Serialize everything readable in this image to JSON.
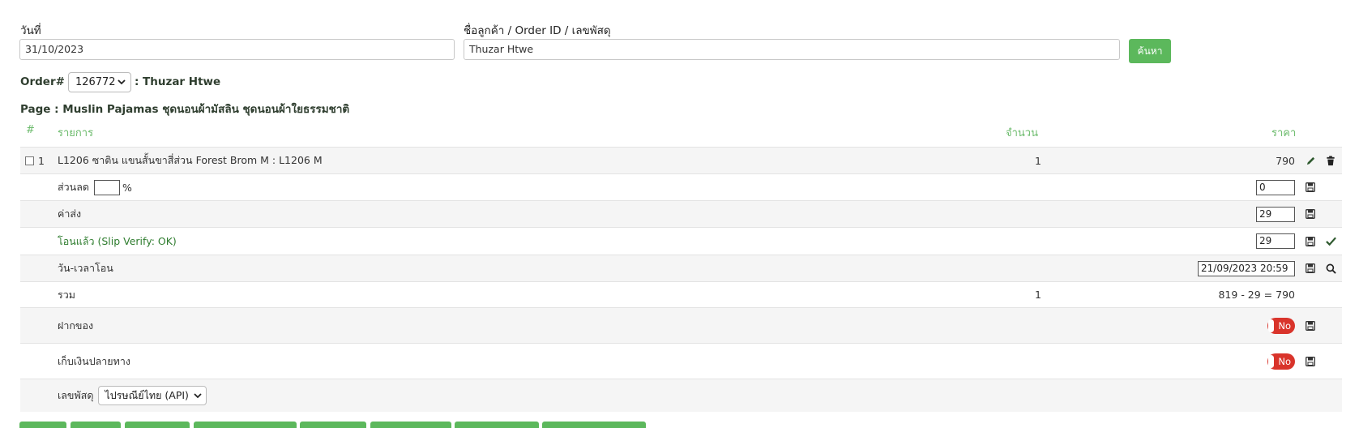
{
  "filters": {
    "date_label": "วันที่",
    "date_value": "31/10/2023",
    "customer_label": "ชื่อลูกค้า / Order ID / เลขพัสดุ",
    "customer_value": "Thuzar Htwe",
    "search_button": "ค้นหา"
  },
  "order": {
    "prefix": "Order#",
    "id": "126772",
    "customer": ": Thuzar Htwe",
    "page_title": "Page : Muslin Pajamas ชุดนอนผ้ามัสลิน ชุดนอนผ้าใยธรรมชาติ"
  },
  "table": {
    "headers": {
      "index": "#",
      "item": "รายการ",
      "qty": "จำนวน",
      "price": "ราคา"
    },
    "item": {
      "index": "1",
      "name": "L1206 ซาติน แขนสั้นขาสี่ส่วน Forest Brom M : L1206 M",
      "qty": "1",
      "price": "790"
    },
    "discount": {
      "label": "ส่วนลด",
      "percent_value": "",
      "percent_sign": "%",
      "value": "0"
    },
    "shipping": {
      "label": "ค่าส่ง",
      "value": "29"
    },
    "transferred": {
      "label": "โอนแล้ว (Slip Verify: OK)",
      "value": "29"
    },
    "transfer_time": {
      "label": "วัน-เวลาโอน",
      "value": "21/09/2023 20:59"
    },
    "total": {
      "label": "รวม",
      "qty": "1",
      "value": "819 - 29 = 790"
    },
    "deposit": {
      "label": "ฝากของ",
      "toggle": "No"
    },
    "cod": {
      "label": "เก็บเงินปลายทาง",
      "toggle": "No"
    },
    "tracking": {
      "label": "เลขพัสดุ",
      "carrier": "ไปรษณีย์ไทย (API)"
    }
  },
  "colors": {
    "accent": "#5cb85c",
    "header_text": "#6cbb6c",
    "toggle_off": "#d9342b",
    "icon": "#2f5a2f"
  }
}
